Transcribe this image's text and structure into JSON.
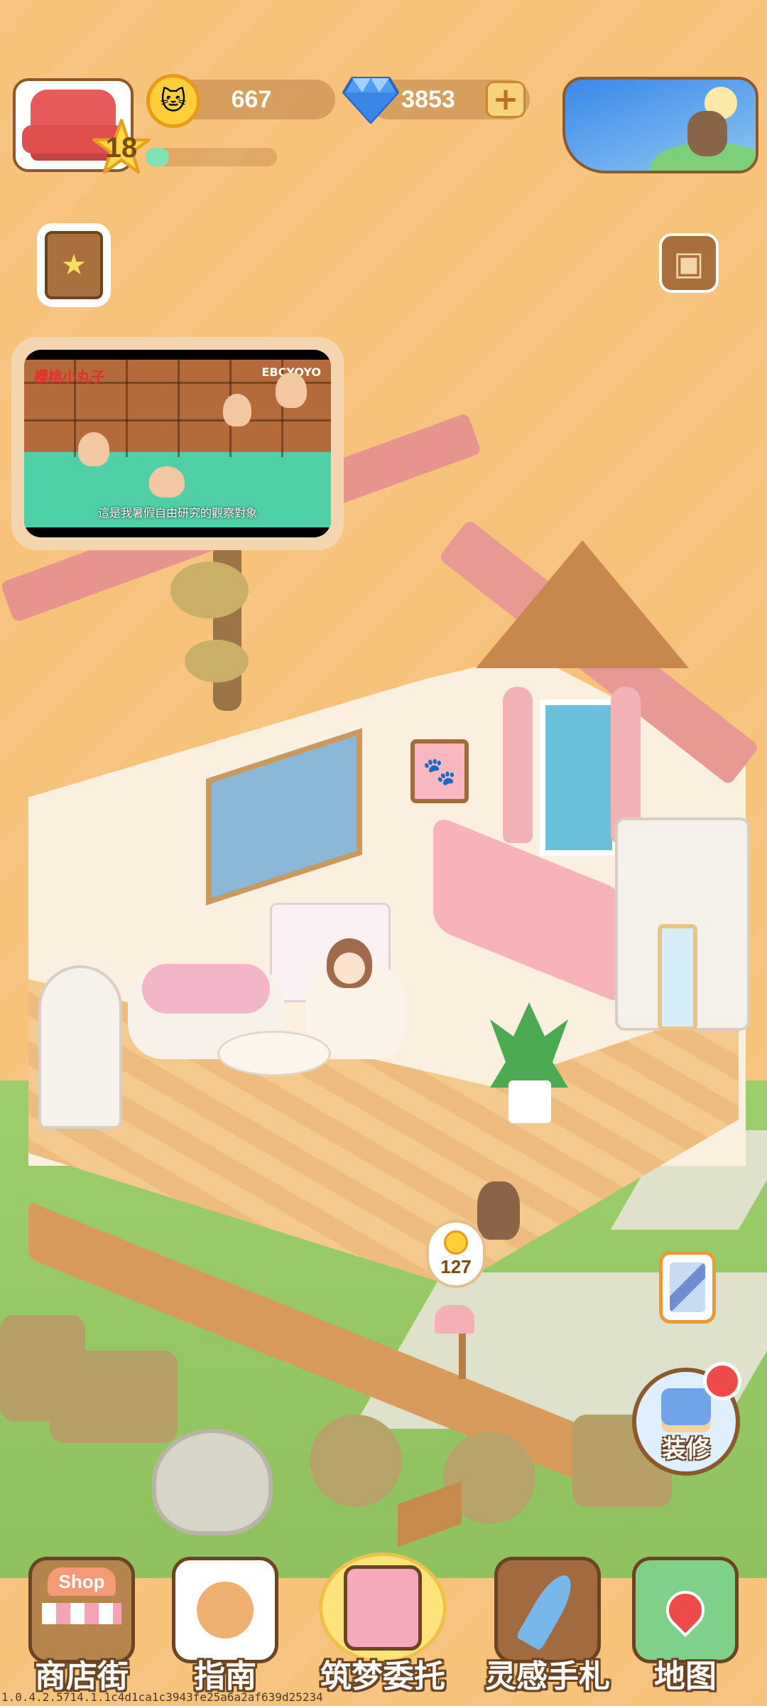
{
  "hud": {
    "level": "18",
    "xp_progress": 0.18,
    "coins": "667",
    "gems": "3853",
    "plus_symbol": "+"
  },
  "scene": {
    "video_channel_logo": "櫻桃小丸子",
    "video_channel": "EBCYOYO",
    "video_subtitle": "這是我暑假自由研究的觀察對象",
    "coin_bubble_value": "127"
  },
  "side_buttons": {
    "renovate_label": "装修"
  },
  "bottom_nav": [
    {
      "label": "商店街",
      "icon": "shop-icon",
      "sign": "Shop"
    },
    {
      "label": "指南",
      "icon": "guide-icon"
    },
    {
      "label": "筑梦委托",
      "icon": "dream-commission-icon"
    },
    {
      "label": "灵感手札",
      "icon": "inspiration-notebook-icon"
    },
    {
      "label": "地图",
      "icon": "map-icon"
    }
  ],
  "version": "1.0.4.2.5714.1.1c4d1ca1c3943fe25a6a2af639d25234",
  "colors": {
    "background": "#f7c27a",
    "accent_red": "#ee4a4a",
    "outline_brown": "#6b4423"
  }
}
